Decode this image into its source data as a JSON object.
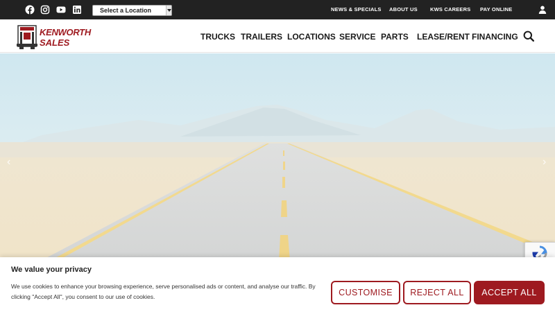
{
  "topbar": {
    "social_icons": [
      "facebook-icon",
      "instagram-icon",
      "youtube-icon",
      "linkedin-icon"
    ],
    "location_select": "Select a Location",
    "links": [
      "NEWS & SPECIALS",
      "ABOUT US",
      "KWS CAREERS",
      "PAY ONLINE"
    ],
    "account_icon": "user-icon"
  },
  "header": {
    "logo_line1": "KENWORTH",
    "logo_line2": "SALES",
    "nav": [
      "TRUCKS",
      "TRAILERS",
      "LOCATIONS",
      "SERVICE",
      "PARTS",
      "LEASE/RENT",
      "FINANCING"
    ],
    "search_icon": "search-icon"
  },
  "hero": {
    "prev_glyph": "‹",
    "next_glyph": "›"
  },
  "cookie": {
    "title": "We value your privacy",
    "text": "We use cookies to enhance your browsing experience, serve personalised ads or content, and analyse our traffic. By clicking \"Accept All\", you consent to our use of cookies.",
    "customise": "CUSTOMISE",
    "reject": "REJECT ALL",
    "accept": "ACCEPT ALL"
  },
  "colors": {
    "brand": "#9e1a20",
    "topbar": "#222222"
  }
}
